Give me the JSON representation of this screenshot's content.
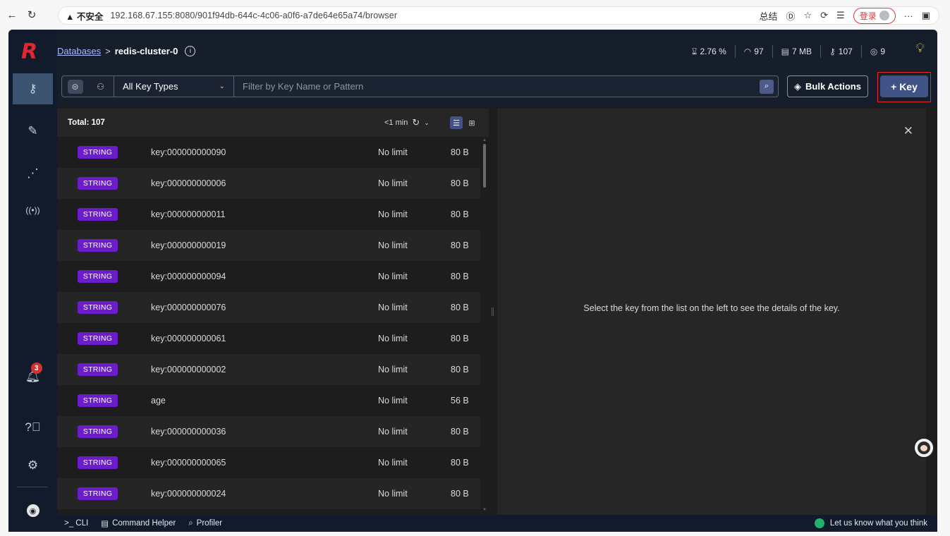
{
  "browser": {
    "insecure_label": "▲ 不安全",
    "url": "192.168.67.155:8080/901f94db-644c-4c06-a0f6-a7de64e65a74/browser",
    "summary_label": "总结",
    "login_label": "登录"
  },
  "header": {
    "breadcrumb_link": "Databases",
    "breadcrumb_sep": ">",
    "breadcrumb_current": "redis-cluster-0",
    "stats": {
      "cpu": "2.76 %",
      "ops": "97",
      "memory": "7 MB",
      "keys": "107",
      "clients": "9"
    }
  },
  "toolbar": {
    "key_type": "All Key Types",
    "filter_placeholder": "Filter by Key Name or Pattern",
    "bulk_actions": "Bulk Actions",
    "add_key": "+ Key"
  },
  "list": {
    "total": "Total: 107",
    "refresh_label": "<1 min",
    "rows": [
      {
        "type": "STRING",
        "key": "key:000000000090",
        "ttl": "No limit",
        "size": "80 B"
      },
      {
        "type": "STRING",
        "key": "key:000000000006",
        "ttl": "No limit",
        "size": "80 B"
      },
      {
        "type": "STRING",
        "key": "key:000000000011",
        "ttl": "No limit",
        "size": "80 B"
      },
      {
        "type": "STRING",
        "key": "key:000000000019",
        "ttl": "No limit",
        "size": "80 B"
      },
      {
        "type": "STRING",
        "key": "key:000000000094",
        "ttl": "No limit",
        "size": "80 B"
      },
      {
        "type": "STRING",
        "key": "key:000000000076",
        "ttl": "No limit",
        "size": "80 B"
      },
      {
        "type": "STRING",
        "key": "key:000000000061",
        "ttl": "No limit",
        "size": "80 B"
      },
      {
        "type": "STRING",
        "key": "key:000000000002",
        "ttl": "No limit",
        "size": "80 B"
      },
      {
        "type": "STRING",
        "key": "age",
        "ttl": "No limit",
        "size": "56 B"
      },
      {
        "type": "STRING",
        "key": "key:000000000036",
        "ttl": "No limit",
        "size": "80 B"
      },
      {
        "type": "STRING",
        "key": "key:000000000065",
        "ttl": "No limit",
        "size": "80 B"
      },
      {
        "type": "STRING",
        "key": "key:000000000024",
        "ttl": "No limit",
        "size": "80 B"
      }
    ]
  },
  "details": {
    "message": "Select the key from the list on the left to see the details of the key."
  },
  "sidebar": {
    "notification_count": "3"
  },
  "bottom": {
    "cli": ">_ CLI",
    "command_helper": "Command Helper",
    "profiler": "Profiler",
    "feedback": "Let us know what you think"
  },
  "colors": {
    "string_badge": "#6a1dc9",
    "add_key_bg": "#3f5387",
    "highlight_outline": "#e3252a",
    "sidebar_bg": "#111b2c"
  }
}
